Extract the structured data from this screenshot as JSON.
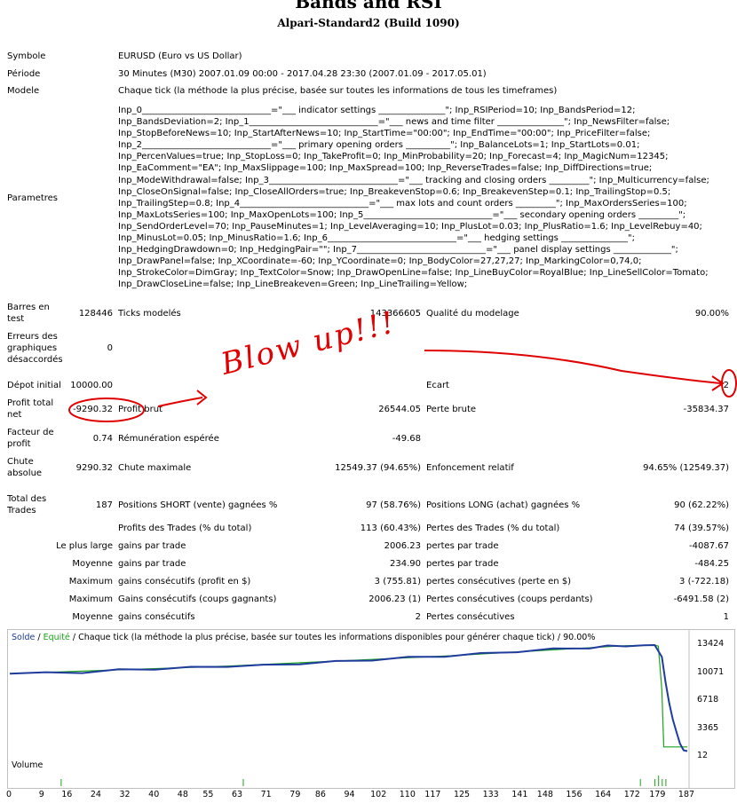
{
  "header": {
    "title": "Bands and RSI",
    "subtitle": "Alpari-Standard2 (Build 1090)"
  },
  "info": {
    "symbole_label": "Symbole",
    "symbole_value": "EURUSD (Euro vs US Dollar)",
    "periode_label": "Période",
    "periode_value": "30 Minutes (M30) 2007.01.09 00:00 - 2017.04.28 23:30 (2007.01.09 - 2017.05.01)",
    "modele_label": "Modele",
    "modele_value": "Chaque tick (la méthode la plus précise, basée sur toutes les informations de tous les timeframes)",
    "parametres_label": "Parametres",
    "parametres_lines": [
      "Inp_0_____________________________=\"___ indicator settings _______________\"; Inp_RSIPeriod=10; Inp_BandsPeriod=12;",
      "Inp_BandsDeviation=2; Inp_1_____________________________=\"___ news and time filter _______________\"; Inp_NewsFilter=false;",
      "Inp_StopBeforeNews=10; Inp_StartAfterNews=10; Inp_StartTime=\"00:00\"; Inp_EndTime=\"00:00\"; Inp_PriceFilter=false;",
      "Inp_2_____________________________=\"___ primary opening orders __________\"; Inp_BalanceLots=1; Inp_StartLots=0.01;",
      "Inp_PercenValues=true; Inp_StopLoss=0; Inp_TakeProfit=0; Inp_MinProbability=20; Inp_Forecast=4; Inp_MagicNum=12345;",
      "Inp_EaComment=\"EA\"; Inp_MaxSlippage=100; Inp_MaxSpread=100; Inp_ReverseTrades=false; Inp_DiffDirections=true;",
      "Inp_ModeWithdrawal=false; Inp_3_____________________________=\"___ tracking and closing orders _________\"; Inp_Multicurrency=false;",
      "Inp_CloseOnSignal=false; Inp_CloseAllOrders=true; Inp_BreakevenStop=0.6; Inp_BreakevenStep=0.1; Inp_TrailingStop=0.5;",
      "Inp_TrailingStep=0.8; Inp_4_____________________________=\"___ max lots and count orders _________\"; Inp_MaxOrdersSeries=100;",
      "Inp_MaxLotsSeries=100; Inp_MaxOpenLots=100; Inp_5_____________________________=\"___ secondary opening orders _________\";",
      "Inp_SendOrderLevel=70; Inp_PauseMinutes=1; Inp_LevelAveraging=10; Inp_PlusLot=0.03; Inp_PlusRatio=1.6; Inp_LevelRebuy=40;",
      "Inp_MinusLot=0.05; Inp_MinusRatio=1.6; Inp_6_____________________________=\"___ hedging settings _______________\";",
      "Inp_HedgingDrawdown=0; Inp_HedgingPair=\"\"; Inp_7_____________________________=\"___ panel display settings _____________\";",
      "Inp_DrawPanel=false; Inp_XCoordinate=-60; Inp_YCoordinate=0; Inp_BodyColor=27,27,27; Inp_MarkingColor=0,74,0;",
      "Inp_StrokeColor=DimGray; Inp_TextColor=Snow; Inp_DrawOpenLine=false; Inp_LineBuyColor=RoyalBlue; Inp_LineSellColor=Tomato;",
      "Inp_DrawCloseLine=false; Inp_LineBreakeven=Green; Inp_LineTrailing=Yellow;"
    ]
  },
  "stats": {
    "barres_label_1": "Barres en",
    "barres_label_2": "test",
    "barres_value": "128446",
    "ticks_label": "Ticks modelés",
    "ticks_value": "143366605",
    "qualite_label": "Qualité du modelage",
    "qualite_value": "90.00%",
    "erreurs_label_1": "Erreurs des",
    "erreurs_label_2": "graphiques",
    "erreurs_label_3": "désaccordés",
    "erreurs_value": "0",
    "depot_label": "Dépot initial",
    "depot_value": "10000.00",
    "ecart_label": "Ecart",
    "ecart_value": "2",
    "profit_total_label_1": "Profit total",
    "profit_total_label_2": "net",
    "profit_total_value": "-9290.32",
    "profit_brut_label": "Profit brut",
    "profit_brut_value": "26544.05",
    "perte_brute_label": "Perte brute",
    "perte_brute_value": "-35834.37",
    "facteur_label_1": "Facteur de",
    "facteur_label_2": "profit",
    "facteur_value": "0.74",
    "remuneration_label": "Rémunération espérée",
    "remuneration_value": "-49.68",
    "chute_label_1": "Chute",
    "chute_label_2": "absolue",
    "chute_value": "9290.32",
    "chute_max_label": "Chute maximale",
    "chute_max_value": "12549.37 (94.65%)",
    "enfoncement_label": "Enfoncement relatif",
    "enfoncement_value": "94.65% (12549.37)",
    "total_trades_label_1": "Total des",
    "total_trades_label_2": "Trades",
    "total_trades_value": "187",
    "short_label": "Positions SHORT (vente) gagnées %",
    "short_value": "97 (58.76%)",
    "long_label": "Positions LONG (achat) gagnées %",
    "long_value": "90 (62.22%)",
    "profits_trades_label": "Profits des Trades (% du total)",
    "profits_trades_value": "113 (60.43%)",
    "pertes_trades_label": "Pertes des Trades (% du total)",
    "pertes_trades_value": "74 (39.57%)",
    "rows": [
      {
        "prefix": "Le plus large",
        "l1": "gains par trade",
        "v1": "2006.23",
        "l2": "pertes par trade",
        "v2": "-4087.67"
      },
      {
        "prefix": "Moyenne",
        "l1": "gains par trade",
        "v1": "234.90",
        "l2": "pertes par trade",
        "v2": "-484.25"
      },
      {
        "prefix": "Maximum",
        "l1": "gains consécutifs (profit en $)",
        "v1": "3 (755.81)",
        "l2": "pertes consécutives (perte en $)",
        "v2": "3 (-722.18)"
      },
      {
        "prefix": "Maximum",
        "l1": "Gains consécutifs (coups gagnants)",
        "v1": "2006.23 (1)",
        "l2": "Pertes consécutives (coups perdants)",
        "v2": "-6491.58 (2)"
      },
      {
        "prefix": "Moyenne",
        "l1": "gains consécutifs",
        "v1": "2",
        "l2": "Pertes consécutives",
        "v2": "1"
      }
    ]
  },
  "annotation": {
    "text": "Blow up!!!"
  },
  "chart_data": {
    "type": "line",
    "legend_solde": "Solde",
    "legend_sep": " / ",
    "legend_equite": "Equité",
    "legend_rest": " / Chaque tick (la méthode la plus précise, basée sur toutes les informations disponibles pour générer chaque tick) / 90.00%",
    "y_ticks": [
      13424,
      10071,
      6718,
      3365,
      12
    ],
    "ylim": [
      12,
      13424
    ],
    "x_ticks": [
      0,
      9,
      16,
      24,
      32,
      40,
      48,
      55,
      63,
      71,
      79,
      86,
      94,
      102,
      110,
      117,
      125,
      133,
      141,
      148,
      156,
      164,
      172,
      179,
      187
    ],
    "xlim": [
      0,
      187
    ],
    "volume_label": "Volume",
    "colors": {
      "solde": "#1f3c9c",
      "equite": "#1aa31a"
    },
    "series": [
      {
        "name": "Solde",
        "x": [
          0,
          10,
          20,
          30,
          40,
          50,
          60,
          70,
          80,
          90,
          100,
          110,
          120,
          130,
          140,
          150,
          160,
          165,
          170,
          175,
          178,
          180,
          181,
          182,
          183,
          184,
          185,
          186,
          187
        ],
        "values": [
          10000,
          10050,
          10150,
          10400,
          10550,
          10700,
          10900,
          10950,
          11200,
          11400,
          11650,
          11900,
          12100,
          12350,
          12650,
          12900,
          13100,
          13250,
          13350,
          13400,
          13424,
          12000,
          9000,
          6500,
          4500,
          3000,
          1600,
          800,
          700
        ]
      },
      {
        "name": "Equité",
        "x": [
          0,
          60,
          120,
          170,
          178,
          179,
          180,
          180.5,
          187
        ],
        "values": [
          10000,
          10900,
          12100,
          13350,
          13424,
          13300,
          8000,
          1200,
          1200
        ]
      }
    ],
    "volume": [
      1,
      1,
      1,
      1,
      1,
      1,
      1,
      1,
      1,
      1,
      1,
      1,
      1,
      1,
      2,
      1,
      1,
      1,
      1,
      1,
      1,
      1,
      1,
      1,
      1,
      1,
      1,
      1,
      1,
      1,
      1,
      1,
      1,
      1,
      1,
      1,
      1,
      1,
      1,
      1,
      1,
      1,
      1,
      1,
      1,
      1,
      1,
      1,
      1,
      1,
      1,
      1,
      1,
      1,
      1,
      1,
      1,
      1,
      1,
      1,
      1,
      1,
      1,
      1,
      2,
      1,
      1,
      1,
      1,
      1,
      1,
      1,
      1,
      1,
      1,
      1,
      1,
      1,
      1,
      1,
      1,
      1,
      1,
      1,
      1,
      1,
      1,
      1,
      1,
      1,
      1,
      1,
      1,
      1,
      1,
      1,
      1,
      1,
      1,
      1,
      1,
      1,
      1,
      1,
      1,
      1,
      1,
      1,
      1,
      1,
      1,
      1,
      1,
      1,
      1,
      1,
      1,
      1,
      1,
      1,
      1,
      1,
      1,
      1,
      1,
      1,
      1,
      1,
      1,
      1,
      1,
      1,
      1,
      1,
      1,
      1,
      1,
      1,
      1,
      1,
      1,
      1,
      1,
      1,
      1,
      1,
      1,
      1,
      1,
      1,
      1,
      1,
      1,
      1,
      1,
      1,
      1,
      1,
      1,
      1,
      1,
      1,
      1,
      1,
      1,
      1,
      1,
      1,
      1,
      1,
      1,
      1,
      1,
      2,
      1,
      1,
      1,
      2,
      3,
      2,
      2,
      1,
      1,
      1,
      1,
      1,
      1
    ]
  }
}
